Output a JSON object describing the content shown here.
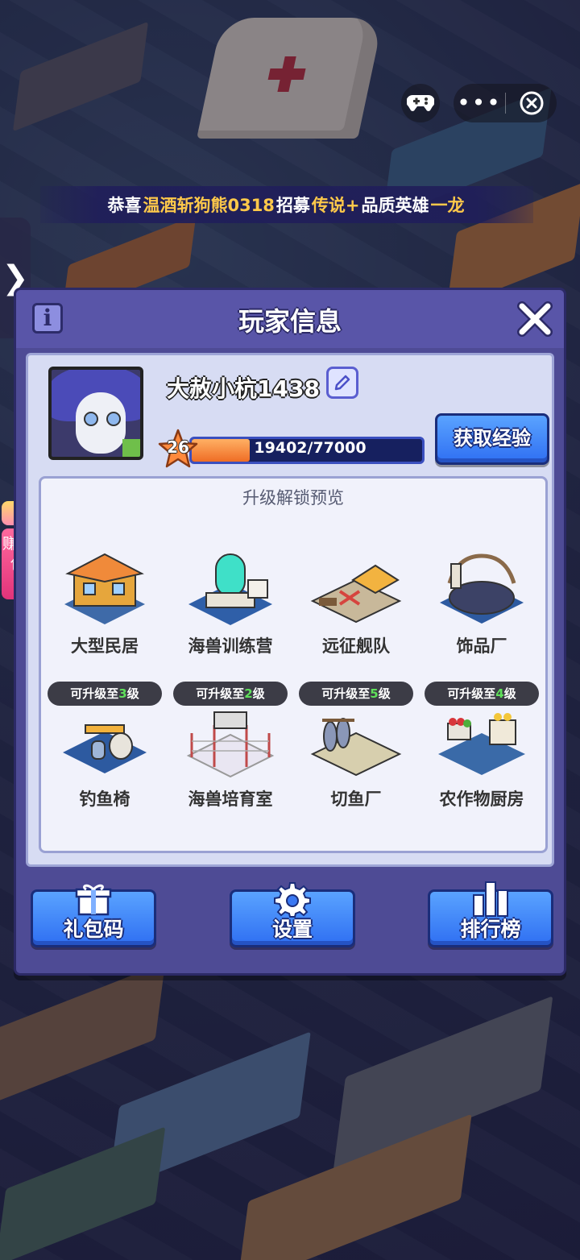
{
  "topbar": {
    "gamepad_icon": "gamepad-icon",
    "more_label": "•••",
    "close_icon": "close-circle-icon"
  },
  "banner": {
    "prefix": "恭喜",
    "player": "温酒斩狗熊0318",
    "action": "招募",
    "quality": "传说+",
    "suffix": "品质英雄",
    "hero": "一龙"
  },
  "side": {
    "arrow": "❯",
    "redpack_label": "赚红包"
  },
  "panel": {
    "title": "玩家信息",
    "info_label": "i",
    "player_name": "大赦小杭1438",
    "level": "26",
    "exp_text": "19402/77000",
    "exp_current": 19402,
    "exp_max": 77000,
    "get_exp_label": "获取经验",
    "preview_title": "升级解锁预览",
    "buildings": [
      {
        "name": "大型民居",
        "tag_prefix": "",
        "tag_level": "",
        "tag_suffix": ""
      },
      {
        "name": "海兽训练营",
        "tag_prefix": "",
        "tag_level": "",
        "tag_suffix": ""
      },
      {
        "name": "远征舰队",
        "tag_prefix": "",
        "tag_level": "",
        "tag_suffix": ""
      },
      {
        "name": "饰品厂",
        "tag_prefix": "",
        "tag_level": "",
        "tag_suffix": ""
      },
      {
        "name": "钓鱼椅",
        "tag_prefix": "可升级至",
        "tag_level": "3",
        "tag_suffix": "级"
      },
      {
        "name": "海兽培育室",
        "tag_prefix": "可升级至",
        "tag_level": "2",
        "tag_suffix": "级"
      },
      {
        "name": "切鱼厂",
        "tag_prefix": "可升级至",
        "tag_level": "5",
        "tag_suffix": "级"
      },
      {
        "name": "农作物厨房",
        "tag_prefix": "可升级至",
        "tag_level": "4",
        "tag_suffix": "级"
      }
    ],
    "buttons": {
      "gift_code": "礼包码",
      "settings": "设置",
      "ranking": "排行榜"
    }
  },
  "colors": {
    "panel": "#4e4b95",
    "inner": "#d7dcf3",
    "button_blue": "#2f6ff2",
    "exp_fill": "#ef6d25",
    "highlight": "#ffc94a",
    "level_green": "#5fe05a"
  }
}
